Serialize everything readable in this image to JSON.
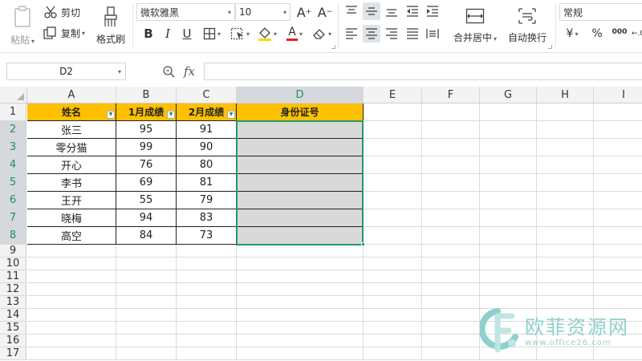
{
  "ribbon": {
    "paste_label": "粘贴",
    "cut_label": "剪切",
    "copy_label": "复制",
    "format_painter_label": "格式刷",
    "font_name": "微软雅黑",
    "font_size": "10",
    "merge_center_label": "合并居中",
    "wrap_text_label": "自动换行",
    "number_format": "常规",
    "currency_symbol": "¥",
    "percent_symbol": "%",
    "thousands_symbol": "000",
    "bold_label": "B",
    "italic_label": "I",
    "underline_label": "U",
    "font_color_label": "A",
    "increase_font_label": "A",
    "decrease_font_label": "A"
  },
  "formula_bar": {
    "cell_reference": "D2",
    "fx_label": "fx",
    "formula_value": ""
  },
  "sheet": {
    "columns": [
      "A",
      "B",
      "C",
      "D",
      "E",
      "F",
      "G",
      "H",
      "I"
    ],
    "rows": [
      "1",
      "2",
      "3",
      "4",
      "5",
      "6",
      "7",
      "8",
      "9",
      "10",
      "11",
      "12",
      "13",
      "14",
      "15",
      "16",
      "17"
    ],
    "headers": [
      "姓名",
      "1月成绩",
      "2月成绩",
      "身份证号"
    ],
    "data": [
      [
        "张三",
        "95",
        "91",
        ""
      ],
      [
        "零分猫",
        "99",
        "90",
        ""
      ],
      [
        "开心",
        "76",
        "80",
        ""
      ],
      [
        "李书",
        "69",
        "81",
        ""
      ],
      [
        "王开",
        "55",
        "79",
        ""
      ],
      [
        "晓梅",
        "94",
        "83",
        ""
      ],
      [
        "高空",
        "84",
        "73",
        ""
      ]
    ],
    "selected_column": "D",
    "selected_rows": [
      "2",
      "3",
      "4",
      "5",
      "6",
      "7",
      "8"
    ]
  },
  "watermark": {
    "text": "欧菲资源网",
    "url": "www.office26.com"
  },
  "colors": {
    "header_fill": "#ffc000",
    "selection_border": "#1f9c64",
    "selected_cell_fill": "#d9d9d9",
    "selected_header_text": "#1f8f5f"
  }
}
